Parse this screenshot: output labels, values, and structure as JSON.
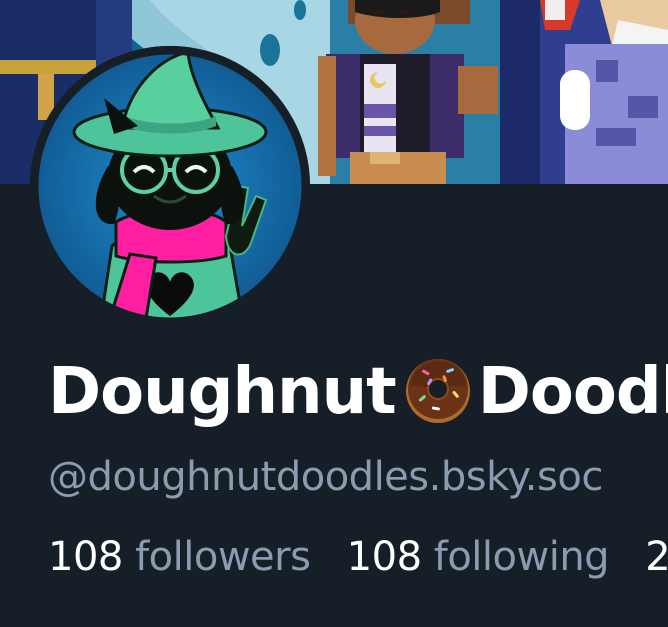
{
  "profile": {
    "display_name_part1": "Doughnut",
    "display_name_part2": "Doodl",
    "handle": "@doughnutdoodles.bsky.soc",
    "followers_count": "108",
    "followers_label": "followers",
    "following_count": "108",
    "following_label": "following",
    "posts_count_partial": "2"
  },
  "colors": {
    "background": "#161e27",
    "primary_text": "#ffffff",
    "secondary_text": "#8b9bb0"
  },
  "icons": {
    "name_emoji": "doughnut-emoji"
  }
}
